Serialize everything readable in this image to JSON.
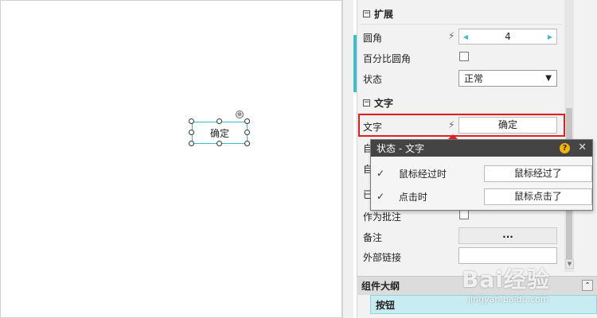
{
  "canvas": {
    "widget_label": "确定"
  },
  "panel": {
    "section_extend": "扩展",
    "corner_label": "圆角",
    "corner_value": "4",
    "percent_corner_label": "百分比圆角",
    "state_label": "状态",
    "state_value": "正常",
    "section_text": "文字",
    "text_label": "文字",
    "text_value": "确定",
    "hidden_row_1": "自",
    "hidden_row_2": "自",
    "hidden_row_3": "已",
    "annotation_label": "作为批注",
    "note_label": "备注",
    "note_button": "...",
    "link_label": "外部链接"
  },
  "popup": {
    "title": "状态 - 文字",
    "help": "?",
    "close": "✕",
    "rows": [
      {
        "label": "鼠标经过时",
        "value": "鼠标经过了",
        "checked": "✓"
      },
      {
        "label": "点击时",
        "value": "鼠标点击了",
        "checked": "✓"
      }
    ]
  },
  "outline": {
    "title": "组件大纲",
    "item": "按钮"
  },
  "watermark": {
    "logo": "Bai经验",
    "url": "jingyan.baidu.com"
  },
  "colors": {
    "accent": "#3cbfcb",
    "highlight": "#e02020",
    "popup_title_bg": "#444444"
  }
}
